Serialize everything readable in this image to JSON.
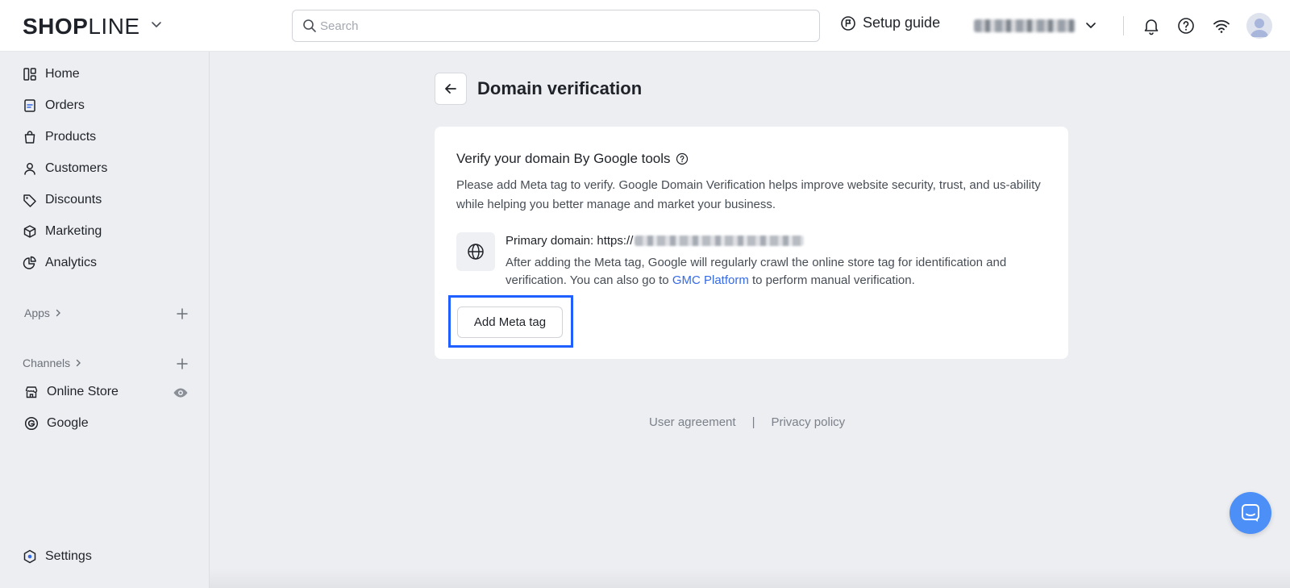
{
  "header": {
    "logo_bold": "SHOP",
    "logo_light": "LINE",
    "search_placeholder": "Search",
    "setup_guide": "Setup guide"
  },
  "sidebar": {
    "items": [
      {
        "label": "Home",
        "icon": "home-icon"
      },
      {
        "label": "Orders",
        "icon": "orders-icon"
      },
      {
        "label": "Products",
        "icon": "products-icon"
      },
      {
        "label": "Customers",
        "icon": "customers-icon"
      },
      {
        "label": "Discounts",
        "icon": "discounts-icon"
      },
      {
        "label": "Marketing",
        "icon": "marketing-icon"
      },
      {
        "label": "Analytics",
        "icon": "analytics-icon"
      }
    ],
    "apps_label": "Apps",
    "channels_label": "Channels",
    "channels": [
      {
        "label": "Online Store",
        "icon": "online-store-icon"
      },
      {
        "label": "Google",
        "icon": "google-icon"
      }
    ],
    "settings_label": "Settings"
  },
  "page": {
    "title": "Domain verification",
    "card": {
      "title": "Verify your domain By Google tools",
      "description": "Please add Meta tag to verify. Google Domain Verification helps improve website security, trust, and us-ability while helping you better manage and market your business.",
      "primary_domain_label": "Primary domain: https://",
      "crawl_text_before": "After adding the Meta tag, Google will regularly crawl the online store tag for identification and verification. You can also go to ",
      "gmc_link": "GMC Platform",
      "crawl_text_after": " to perform manual verification.",
      "add_meta_button": "Add Meta tag"
    }
  },
  "footer": {
    "user_agreement": "User agreement",
    "separator": "|",
    "privacy_policy": "Privacy policy"
  },
  "colors": {
    "accent": "#356ae6",
    "highlight": "#1f5fff",
    "chat": "#4b8ff7"
  }
}
